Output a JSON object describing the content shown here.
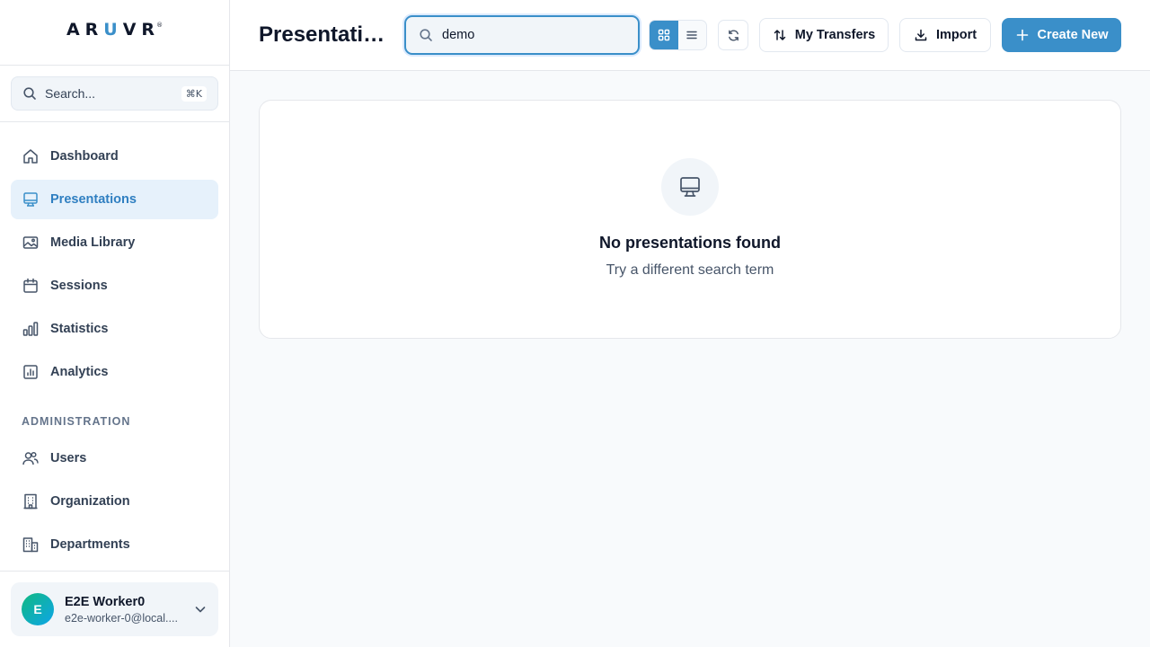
{
  "brand": {
    "logo_a": "AR",
    "logo_u": "U",
    "logo_b": "VR",
    "reg": "®"
  },
  "sidebar": {
    "search_placeholder": "Search...",
    "search_shortcut": "⌘K",
    "items": [
      {
        "label": "Dashboard",
        "icon": "home-icon"
      },
      {
        "label": "Presentations",
        "icon": "monitor-icon",
        "active": true
      },
      {
        "label": "Media Library",
        "icon": "image-icon"
      },
      {
        "label": "Sessions",
        "icon": "calendar-icon"
      },
      {
        "label": "Statistics",
        "icon": "bar-chart-icon"
      },
      {
        "label": "Analytics",
        "icon": "analytics-icon"
      }
    ],
    "admin_label": "ADMINISTRATION",
    "admin_items": [
      {
        "label": "Users",
        "icon": "users-icon"
      },
      {
        "label": "Organization",
        "icon": "building-icon"
      },
      {
        "label": "Departments",
        "icon": "buildings-icon"
      }
    ]
  },
  "user": {
    "initial": "E",
    "name": "E2E Worker0",
    "email": "e2e-worker-0@local...."
  },
  "header": {
    "title": "Presentations",
    "search_value": "demo",
    "view_mode": "grid",
    "transfers_label": "My Transfers",
    "import_label": "Import",
    "create_label": "Create New"
  },
  "empty_state": {
    "title": "No presentations found",
    "subtitle": "Try a different search term",
    "icon": "monitor-icon"
  },
  "colors": {
    "accent": "#3a8fc9",
    "active_bg": "#e6f1fb",
    "page_bg": "#f8fafc"
  }
}
